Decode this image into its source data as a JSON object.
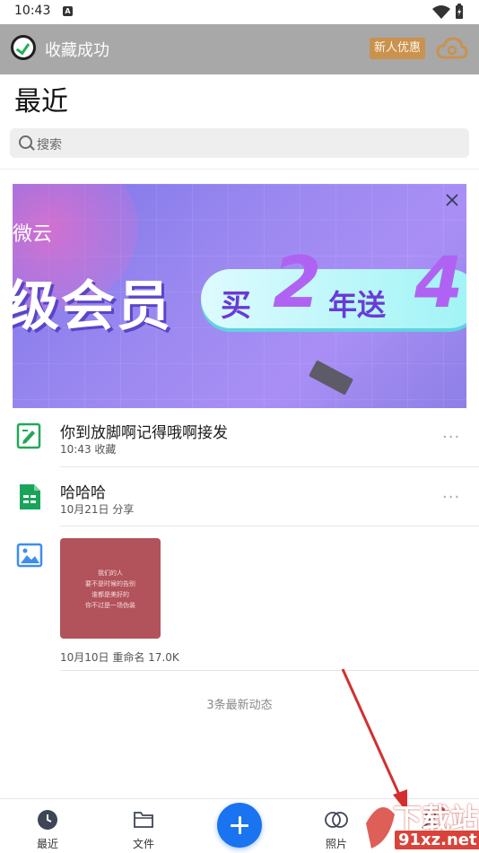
{
  "status_bar": {
    "time": "10:43",
    "notif_badge": "A"
  },
  "toast": {
    "message": "收藏成功",
    "promo_label": "新人优惠"
  },
  "header": {
    "title": "最近",
    "search_placeholder": "搜索"
  },
  "banner": {
    "brand": "微云",
    "headline": "级会员",
    "offer_part1": "买",
    "offer_num1": "2",
    "offer_part2": "年送",
    "offer_num2": "4"
  },
  "items": [
    {
      "title": "你到放脚啊记得哦啊接发",
      "meta": "10:43  收藏",
      "more": "···"
    },
    {
      "title": "哈哈哈",
      "meta": "10月21日  分享",
      "more": "···"
    },
    {
      "meta": "10月10日  重命名  17.0K"
    }
  ],
  "thumbnail_text": [
    "我们的人",
    "要不是时候的告别",
    "谁都是美好的",
    "你不过是一场伪装"
  ],
  "footer_note": "3条最新动态",
  "bottom_nav": {
    "recent": "最近",
    "files": "文件",
    "photos": "照片",
    "me": "我的"
  },
  "watermark": {
    "line1": "下载站",
    "line2": "91xz.net"
  },
  "colors": {
    "accent": "#1a73f0",
    "toast_bg": "#a8a8a8",
    "promo": "#c9924f"
  }
}
